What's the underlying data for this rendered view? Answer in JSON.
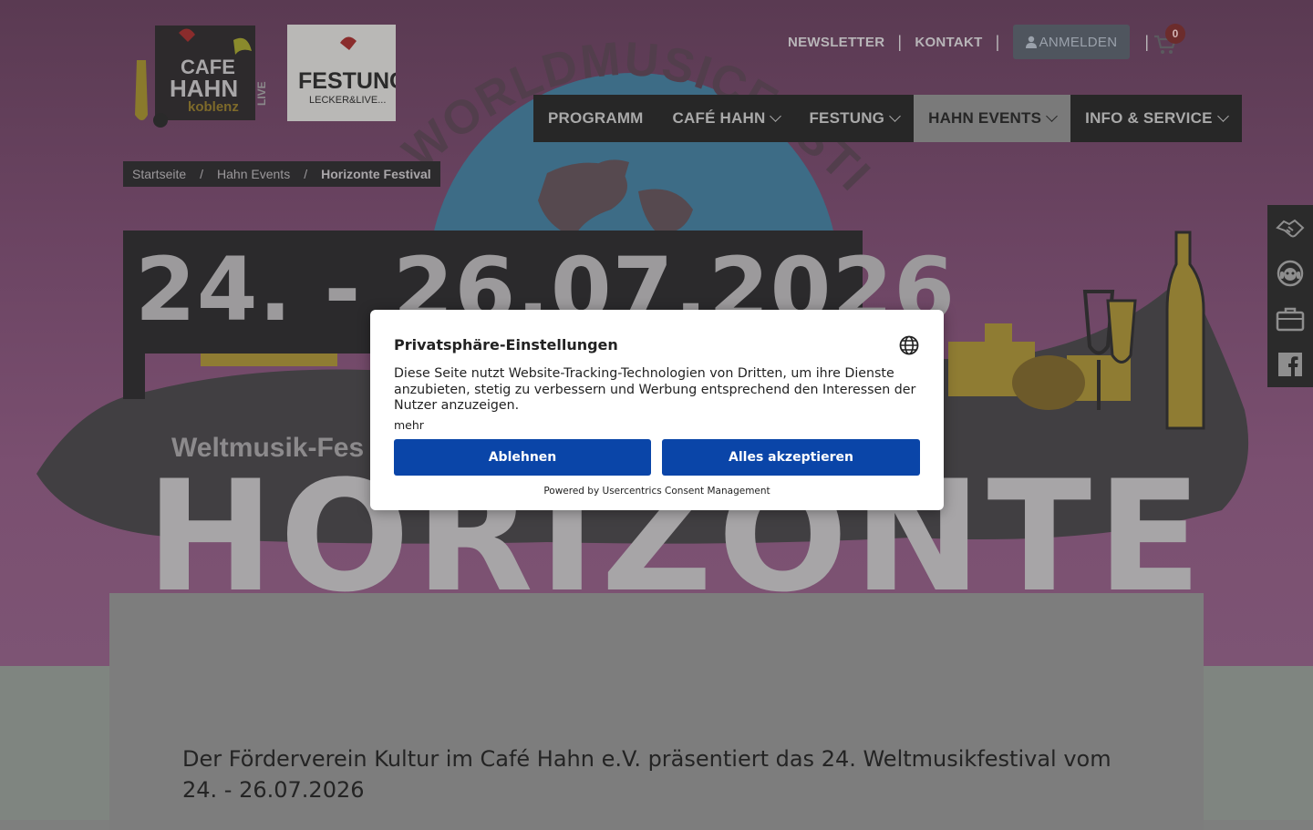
{
  "logos": {
    "cafe_hahn": {
      "line1": "CAFE",
      "line2": "HAHN",
      "line3": "koblenz",
      "side": "LIVE"
    },
    "festung": {
      "line1": "FESTUNG",
      "line2": "LECKER&LIVE..."
    }
  },
  "toplinks": {
    "newsletter": "NEWSLETTER",
    "separator": "|",
    "kontakt": "KONTAKT",
    "anmelden": "ANMELDEN",
    "cart_count": "0"
  },
  "nav": {
    "items": [
      {
        "label": "PROGRAMM"
      },
      {
        "label": "CAFÉ HAHN"
      },
      {
        "label": "FESTUNG"
      },
      {
        "label": "HAHN EVENTS"
      },
      {
        "label": "INFO & SERVICE"
      }
    ]
  },
  "breadcrumb": {
    "home": "Startseite",
    "sep": "/",
    "parent": "Hahn Events",
    "current": "Horizonte Festival"
  },
  "hero": {
    "date": "24. - 26.07.2026",
    "subtitle": "Weltmusik-Fes",
    "big": "HORIZONTE",
    "arc_text": "WORLDMUSICFESTIVAL"
  },
  "content": {
    "intro": "Der Förderverein Kultur im Café Hahn e.V. präsentiert das 24. Weltmusikfestival vom 24. - 26.07.2026"
  },
  "sidedock": {
    "icons": [
      "handshake-icon",
      "support-headset-icon",
      "briefcase-icon",
      "facebook-icon"
    ]
  },
  "consent": {
    "title": "Privatsphäre-Einstellungen",
    "text": "Diese Seite nutzt Website-Tracking-Technologien von Dritten, um ihre Dienste anzubieten, stetig zu verbessern und Werbung entsprechend den Interessen der Nutzer anzuzeigen.",
    "more": "mehr",
    "decline": "Ablehnen",
    "accept": "Alles akzeptieren",
    "powered": "Powered by Usercentrics Consent Management"
  },
  "colors": {
    "accent_blue": "#0a45a8",
    "nav_bg": "#272727",
    "nav_active_bg": "#7a7a7a",
    "hero_purple": "#6b4462"
  }
}
